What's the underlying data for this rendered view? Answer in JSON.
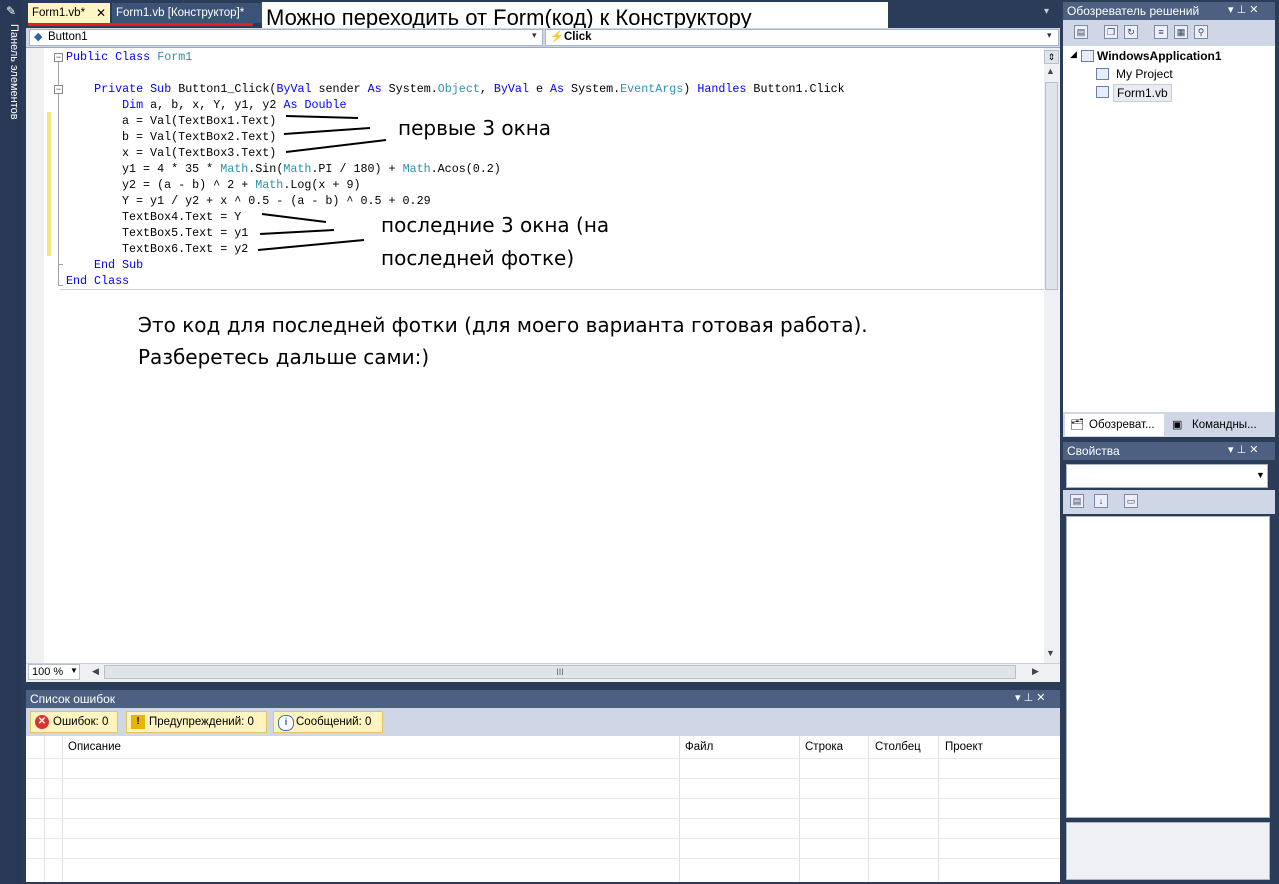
{
  "toolbox": {
    "label": "Панель элементов",
    "icon": "wrench-icon"
  },
  "tabs": {
    "active": {
      "label": "Form1.vb*",
      "close": "✕"
    },
    "inactive": {
      "label": "Form1.vb [Конструктор]*"
    }
  },
  "annotations": {
    "top": "Можно переходить от Form(код) к Конструктору",
    "first_three": "первые 3 окна",
    "last_three_line1": "последние 3 окна (на",
    "last_three_line2": "последней фотке)",
    "bottom_line1": "Это код для последней фотки (для моего варианта готовая работа).",
    "bottom_line2": "Разберетесь дальше сами:)"
  },
  "navbar": {
    "object": "Button1",
    "member": "Click"
  },
  "code": {
    "l1_kw": "Public Class",
    "l1_ty": "Form1",
    "l2_kw1": "Private Sub",
    "l2_t1": " Button1_Click(",
    "l2_kw2": "ByVal",
    "l2_t2": " sender ",
    "l2_kw3": "As",
    "l2_t3": " System.",
    "l2_ty1": "Object",
    "l2_t4": ", ",
    "l2_kw4": "ByVal",
    "l2_t5": " e ",
    "l2_kw5": "As",
    "l2_t6": " System.",
    "l2_ty2": "EventArgs",
    "l2_t7": ") ",
    "l2_kw6": "Handles",
    "l2_t8": " Button1.Click",
    "l3_kw1": "Dim",
    "l3_t1": " a, b, x, Y, y1, y2 ",
    "l3_kw2": "As Double",
    "l4": "a = Val(TextBox1.Text)",
    "l5": "b = Val(TextBox2.Text)",
    "l6": "x = Val(TextBox3.Text)",
    "l7_t1": "y1 = 4 * 35 * ",
    "l7_ty1": "Math",
    "l7_t2": ".Sin(",
    "l7_ty2": "Math",
    "l7_t3": ".PI / 180) + ",
    "l7_ty3": "Math",
    "l7_t4": ".Acos(0.2)",
    "l8_t1": "y2 = (a - b) ^ 2 + ",
    "l8_ty1": "Math",
    "l8_t2": ".Log(x + 9)",
    "l9": "Y = y1 / y2 + x ^ 0.5 - (a - b) ^ 0.5 + 0.29",
    "l10": "TextBox4.Text = Y",
    "l11": "TextBox5.Text = y1",
    "l12": "TextBox6.Text = y2",
    "l13": "End Sub",
    "l14": "End Class"
  },
  "editor_status": {
    "zoom": "100 %",
    "hscroll_grip": "III"
  },
  "error_list": {
    "title": "Список ошибок",
    "errors": "Ошибок: 0",
    "warnings": "Предупреждений: 0",
    "messages": "Сообщений: 0",
    "columns": [
      "Описание",
      "Файл",
      "Строка",
      "Столбец",
      "Проект"
    ]
  },
  "solution_explorer": {
    "title": "Обозреватель решений",
    "project": "WindowsApplication1",
    "items": [
      "My Project",
      "Form1.vb"
    ],
    "tab1": "Обозреват...",
    "tab2": "Командны..."
  },
  "properties": {
    "title": "Свойства"
  },
  "panel_controls": "▾ ⊥ ✕",
  "colors": {
    "keyword": "#0000ff",
    "type": "#2b91af",
    "annotation_underline": "#e5201c",
    "ide_frame": "#2b3c59"
  }
}
